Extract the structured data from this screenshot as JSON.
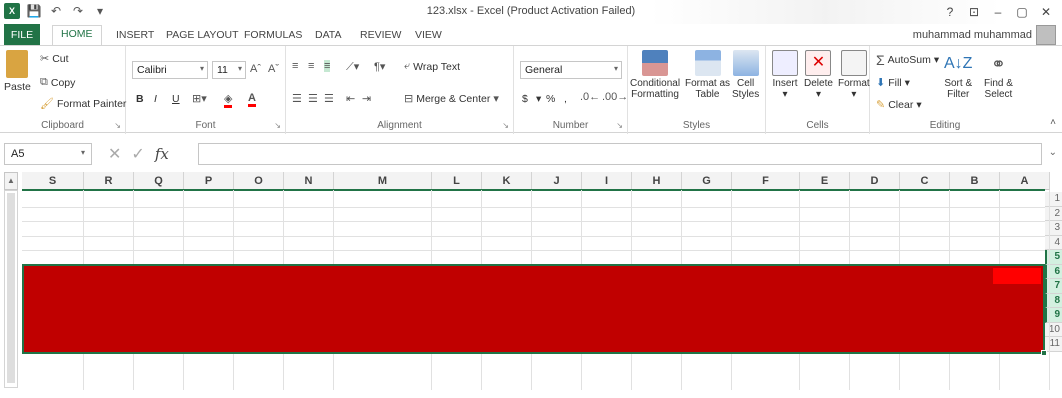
{
  "window": {
    "title": "123.xlsx - Excel (Product Activation Failed)",
    "controls": [
      "?",
      "⊡",
      "–",
      "▢",
      "✕"
    ]
  },
  "tabs": [
    {
      "label": "FILE"
    },
    {
      "label": "HOME"
    },
    {
      "label": "INSERT"
    },
    {
      "label": "PAGE LAYOUT"
    },
    {
      "label": "FORMULAS"
    },
    {
      "label": "DATA"
    },
    {
      "label": "REVIEW"
    },
    {
      "label": "VIEW"
    }
  ],
  "user": "muhammad muhammad",
  "ribbon": {
    "clipboard": {
      "label": "Clipboard",
      "paste": "Paste",
      "cut": "Cut",
      "copy": "Copy",
      "format_painter": "Format Painter"
    },
    "font": {
      "label": "Font",
      "name": "Calibri",
      "size": "11",
      "bold": "B",
      "italic": "I",
      "underline": "U"
    },
    "alignment": {
      "label": "Alignment",
      "wrap": "Wrap Text",
      "merge": "Merge & Center"
    },
    "number": {
      "label": "Number",
      "format": "General",
      "currency": "$",
      "percent": "%",
      "comma": ","
    },
    "styles": {
      "label": "Styles",
      "conditional": "Conditional",
      "conditional2": "Formatting",
      "format_table": "Format as",
      "format_table2": "Table",
      "cell_styles": "Cell",
      "cell_styles2": "Styles"
    },
    "cells": {
      "label": "Cells",
      "insert": "Insert",
      "delete": "Delete",
      "format": "Format"
    },
    "editing": {
      "label": "Editing",
      "autosum": "AutoSum",
      "fill": "Fill",
      "clear": "Clear",
      "sort": "Sort &",
      "sort2": "Filter",
      "find": "Find &",
      "find2": "Select"
    }
  },
  "formula_bar": {
    "name_box": "A5",
    "fx": "fx",
    "value": ""
  },
  "columns": [
    "S",
    "R",
    "Q",
    "P",
    "O",
    "N",
    "M",
    "L",
    "K",
    "J",
    "I",
    "H",
    "G",
    "F",
    "E",
    "D",
    "C",
    "B",
    "A"
  ],
  "rows": [
    "1",
    "2",
    "3",
    "4",
    "5",
    "6",
    "7",
    "8",
    "9",
    "10",
    "11"
  ],
  "selected_rows": [
    "5",
    "6",
    "7",
    "8",
    "9"
  ],
  "colors": {
    "accent": "#217346",
    "selection_fill": "#c00000",
    "active_cell": "#ff0000"
  }
}
